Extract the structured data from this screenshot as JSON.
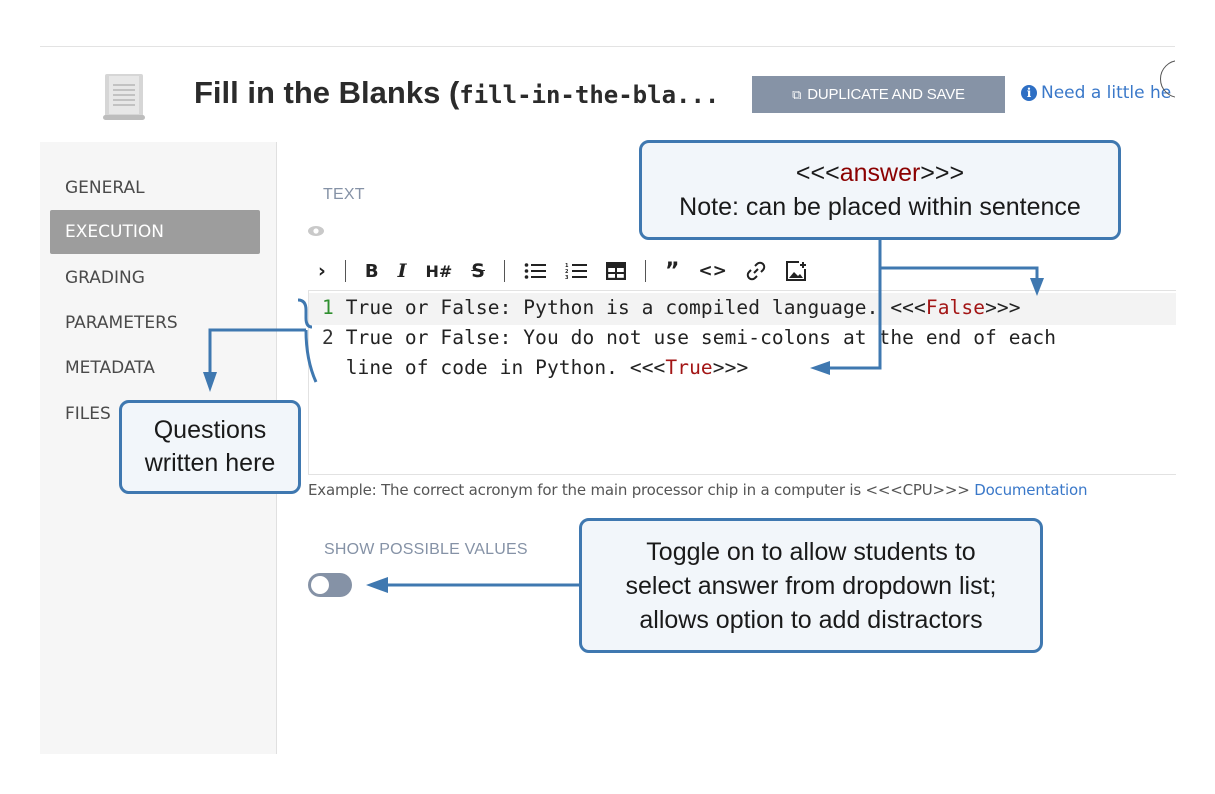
{
  "header": {
    "title": "Fill in the Blanks",
    "slug": "fill-in-the-bla...",
    "duplicate_label": "DUPLICATE AND SAVE",
    "help_text": "Need a little he"
  },
  "sidebar": {
    "items": [
      {
        "label": "GENERAL",
        "active": false
      },
      {
        "label": "EXECUTION",
        "active": true
      },
      {
        "label": "GRADING",
        "active": false
      },
      {
        "label": "PARAMETERS",
        "active": false
      },
      {
        "label": "METADATA",
        "active": false
      },
      {
        "label": "FILES",
        "active": false
      }
    ]
  },
  "text_section": {
    "label": "TEXT",
    "toolbar": [
      "preview-toggle",
      "bold",
      "italic",
      "heading",
      "strikethrough",
      "bullet-list",
      "numbered-list",
      "table",
      "quote",
      "code",
      "link",
      "image"
    ],
    "lines": [
      {
        "number": "1",
        "text": "True or False: Python is a compiled language. ",
        "tag_open": "<<<",
        "answer": "False",
        "tag_close": ">>>"
      },
      {
        "number": "2",
        "text": "True or False: You do not use semi-colons at the end of each"
      },
      {
        "number": "",
        "text": "line of code in Python. ",
        "tag_open": "<<<",
        "answer": "True",
        "tag_close": ">>>"
      }
    ],
    "example_text": "Example: The correct acronym for the main processor chip in a computer is <<<CPU>>>",
    "documentation_link": "Documentation"
  },
  "show_possible_values": {
    "label": "SHOW POSSIBLE VALUES",
    "enabled": false
  },
  "callouts": {
    "answer_prefix": "<<<",
    "answer_word": "answer",
    "answer_suffix": ">>>",
    "answer_note": "Note: can be placed within sentence",
    "questions_line1": "Questions",
    "questions_line2": "written here",
    "toggle_line1": "Toggle on to allow students to",
    "toggle_line2": "select answer from dropdown list;",
    "toggle_line3": "allows option to add distractors"
  },
  "colors": {
    "button": "#8693a6",
    "active_nav": "#9d9d9d",
    "callout_border": "#3f78b0",
    "answer_tag": "#a31515",
    "link": "#3a78c9"
  }
}
